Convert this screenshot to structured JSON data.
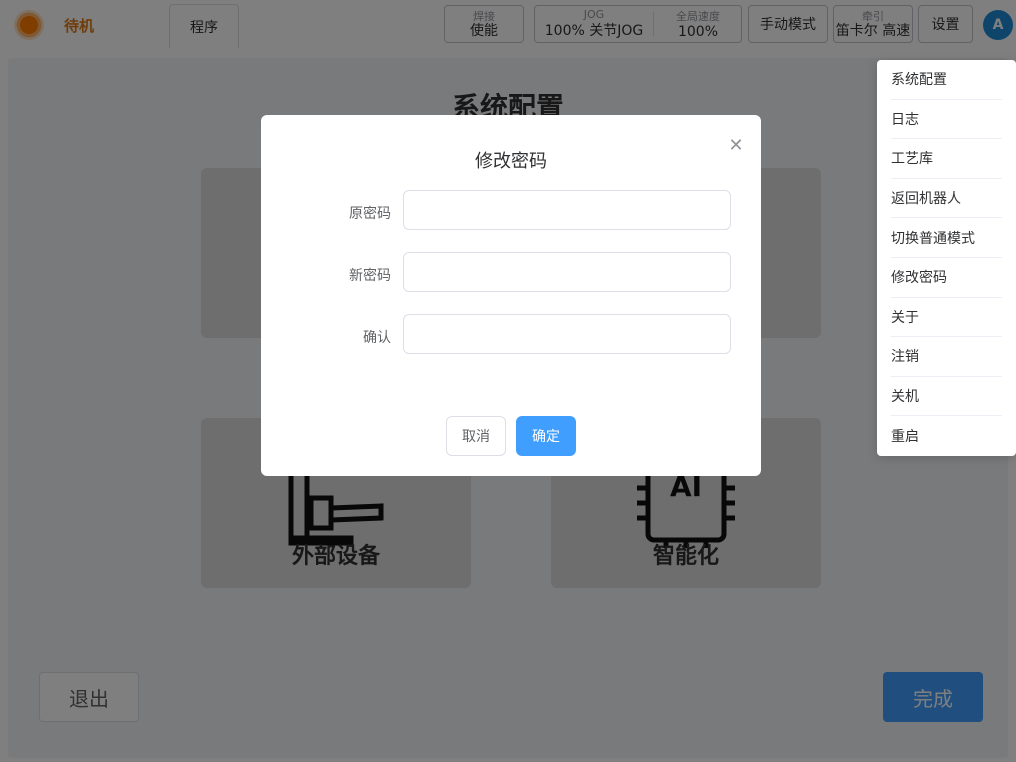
{
  "topbar": {
    "status_text": "待机",
    "tab_program": "程序",
    "weld": {
      "caption": "焊接",
      "value": "使能"
    },
    "jog": {
      "caption": "JOG",
      "value": "100%  关节JOG"
    },
    "global_speed": {
      "caption": "全局速度",
      "value": "100%"
    },
    "manual_mode": "手动模式",
    "traction": {
      "caption": "牵引",
      "value": "笛卡尔 高速"
    },
    "settings": "设置",
    "avatar": "A"
  },
  "main": {
    "title": "系统配置",
    "cards": [
      "外部设备",
      "智能化"
    ],
    "exit_label": "退出",
    "done_label": "完成"
  },
  "menu": {
    "items": [
      "系统配置",
      "日志",
      "工艺库",
      "返回机器人",
      "切换普通模式",
      "修改密码",
      "关于",
      "注销",
      "关机",
      "重启"
    ]
  },
  "dialog": {
    "title": "修改密码",
    "close_icon": "close-icon",
    "fields": [
      {
        "label": "原密码",
        "value": ""
      },
      {
        "label": "新密码",
        "value": ""
      },
      {
        "label": "确认",
        "value": ""
      }
    ],
    "cancel_label": "取消",
    "ok_label": "确定"
  },
  "colors": {
    "accent": "#409eff",
    "status": "#e07a12",
    "avatar": "#1f8ad6"
  }
}
